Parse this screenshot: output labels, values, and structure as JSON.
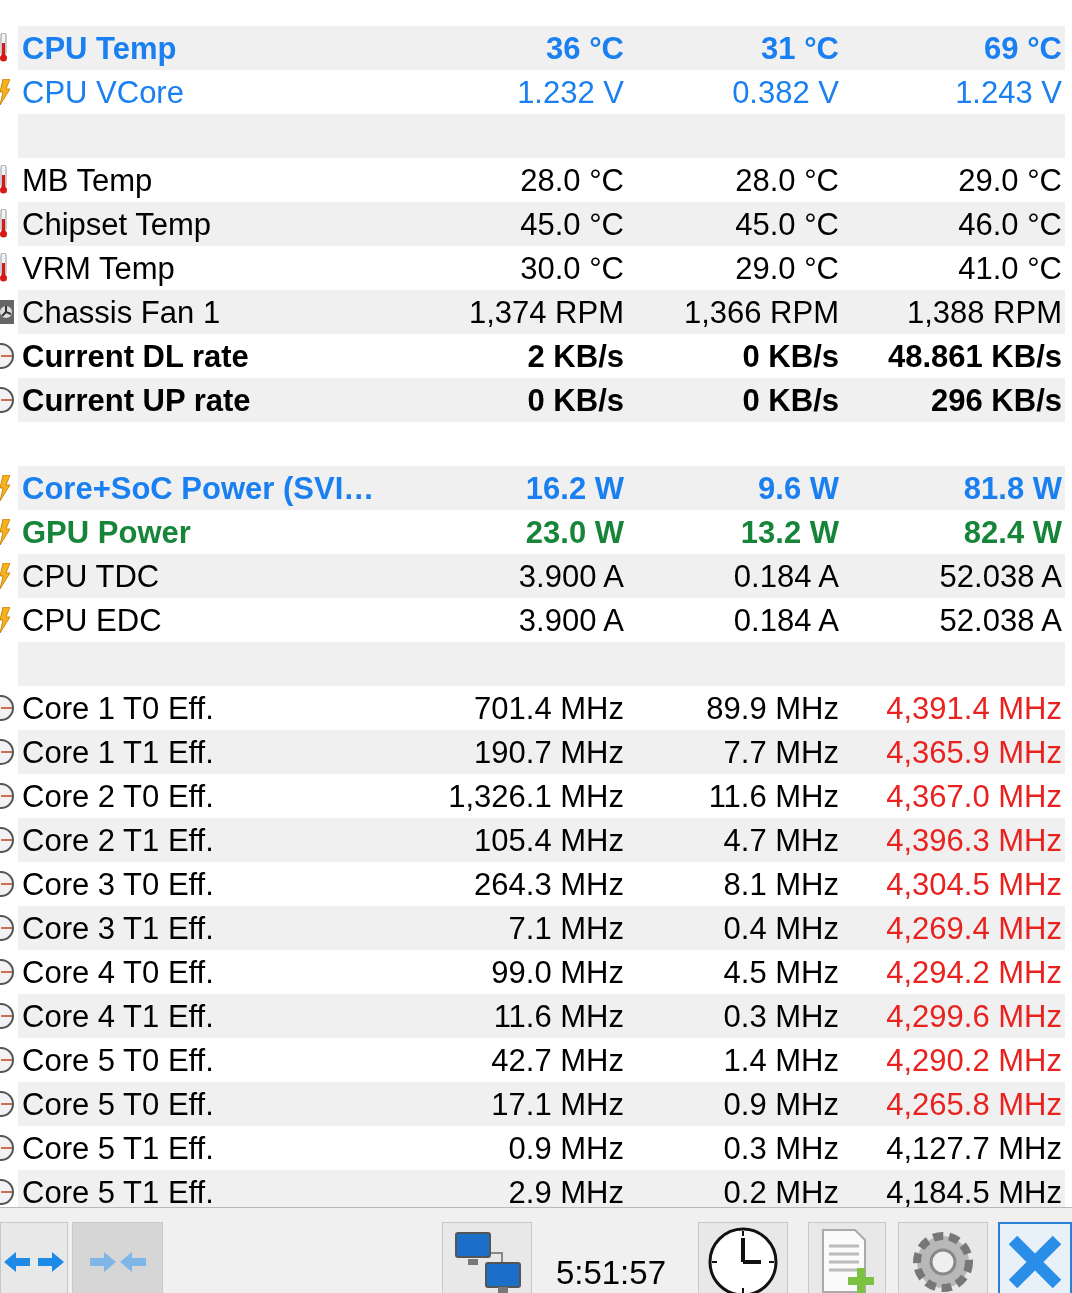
{
  "rows": [
    {
      "kind": "temperature",
      "bold": true,
      "color": "#1a7ff0",
      "name": "CPU Temp",
      "current": "36 °C",
      "minimum": "31 °C",
      "maximum": "69 °C",
      "max_alert": false
    },
    {
      "kind": "voltage",
      "bold": false,
      "color": "#1a7ff0",
      "name": "CPU VCore",
      "current": "1.232 V",
      "minimum": "0.382 V",
      "maximum": "1.243 V",
      "max_alert": false
    },
    {
      "kind": "gap"
    },
    {
      "kind": "temperature",
      "bold": false,
      "color": "#000000",
      "name": "MB Temp",
      "current": "28.0 °C",
      "minimum": "28.0 °C",
      "maximum": "29.0 °C",
      "max_alert": false
    },
    {
      "kind": "temperature",
      "bold": false,
      "color": "#000000",
      "name": "Chipset Temp",
      "current": "45.0 °C",
      "minimum": "45.0 °C",
      "maximum": "46.0 °C",
      "max_alert": false
    },
    {
      "kind": "temperature",
      "bold": false,
      "color": "#000000",
      "name": "VRM Temp",
      "current": "30.0 °C",
      "minimum": "29.0 °C",
      "maximum": "41.0 °C",
      "max_alert": false
    },
    {
      "kind": "fan",
      "bold": false,
      "color": "#000000",
      "name": "Chassis Fan 1",
      "current": "1,374 RPM",
      "minimum": "1,366 RPM",
      "maximum": "1,388 RPM",
      "max_alert": false
    },
    {
      "kind": "rate",
      "bold": true,
      "color": "#000000",
      "name": "Current DL rate",
      "current": "2 KB/s",
      "minimum": "0 KB/s",
      "maximum": "48.861 KB/s",
      "max_alert": false
    },
    {
      "kind": "rate",
      "bold": true,
      "color": "#000000",
      "name": "Current UP rate",
      "current": "0 KB/s",
      "minimum": "0 KB/s",
      "maximum": "296 KB/s",
      "max_alert": false
    },
    {
      "kind": "gap"
    },
    {
      "kind": "power",
      "bold": true,
      "color": "#1a7ff0",
      "name": "Core+SoC Power (SVI…",
      "current": "16.2 W",
      "minimum": "9.6 W",
      "maximum": "81.8 W",
      "max_alert": false
    },
    {
      "kind": "power",
      "bold": true,
      "color": "#16853a",
      "name": "GPU Power",
      "current": "23.0 W",
      "minimum": "13.2 W",
      "maximum": "82.4 W",
      "max_alert": false
    },
    {
      "kind": "power",
      "bold": false,
      "color": "#000000",
      "name": "CPU TDC",
      "current": "3.900 A",
      "minimum": "0.184 A",
      "maximum": "52.038 A",
      "max_alert": false
    },
    {
      "kind": "power",
      "bold": false,
      "color": "#000000",
      "name": "CPU EDC",
      "current": "3.900 A",
      "minimum": "0.184 A",
      "maximum": "52.038 A",
      "max_alert": false
    },
    {
      "kind": "gap"
    },
    {
      "kind": "clock",
      "bold": false,
      "color": "#000000",
      "name": "Core 1 T0 Eff.",
      "current": "701.4 MHz",
      "minimum": "89.9 MHz",
      "maximum": "4,391.4 MHz",
      "max_alert": true
    },
    {
      "kind": "clock",
      "bold": false,
      "color": "#000000",
      "name": "Core 1 T1 Eff.",
      "current": "190.7 MHz",
      "minimum": "7.7 MHz",
      "maximum": "4,365.9 MHz",
      "max_alert": true
    },
    {
      "kind": "clock",
      "bold": false,
      "color": "#000000",
      "name": "Core 2 T0 Eff.",
      "current": "1,326.1 MHz",
      "minimum": "11.6 MHz",
      "maximum": "4,367.0 MHz",
      "max_alert": true
    },
    {
      "kind": "clock",
      "bold": false,
      "color": "#000000",
      "name": "Core 2 T1 Eff.",
      "current": "105.4 MHz",
      "minimum": "4.7 MHz",
      "maximum": "4,396.3 MHz",
      "max_alert": true
    },
    {
      "kind": "clock",
      "bold": false,
      "color": "#000000",
      "name": "Core 3 T0 Eff.",
      "current": "264.3 MHz",
      "minimum": "8.1 MHz",
      "maximum": "4,304.5 MHz",
      "max_alert": true
    },
    {
      "kind": "clock",
      "bold": false,
      "color": "#000000",
      "name": "Core 3 T1 Eff.",
      "current": "7.1 MHz",
      "minimum": "0.4 MHz",
      "maximum": "4,269.4 MHz",
      "max_alert": true
    },
    {
      "kind": "clock",
      "bold": false,
      "color": "#000000",
      "name": "Core 4 T0 Eff.",
      "current": "99.0 MHz",
      "minimum": "4.5 MHz",
      "maximum": "4,294.2 MHz",
      "max_alert": true
    },
    {
      "kind": "clock",
      "bold": false,
      "color": "#000000",
      "name": "Core 4 T1 Eff.",
      "current": "11.6 MHz",
      "minimum": "0.3 MHz",
      "maximum": "4,299.6 MHz",
      "max_alert": true
    },
    {
      "kind": "clock",
      "bold": false,
      "color": "#000000",
      "name": "Core 5 T0 Eff.",
      "current": "42.7 MHz",
      "minimum": "1.4 MHz",
      "maximum": "4,290.2 MHz",
      "max_alert": true
    },
    {
      "kind": "clock",
      "bold": false,
      "color": "#000000",
      "name": "Core 5 T0 Eff.",
      "current": "17.1 MHz",
      "minimum": "0.9 MHz",
      "maximum": "4,265.8 MHz",
      "max_alert": true
    },
    {
      "kind": "clock",
      "bold": false,
      "color": "#000000",
      "name": "Core 5 T1 Eff.",
      "current": "0.9 MHz",
      "minimum": "0.3 MHz",
      "maximum": "4,127.7 MHz",
      "max_alert": false
    },
    {
      "kind": "clock",
      "bold": false,
      "color": "#000000",
      "name": "Core 5 T1 Eff.",
      "current": "2.9 MHz",
      "minimum": "0.2 MHz",
      "maximum": "4,184.5 MHz",
      "max_alert": false
    }
  ],
  "toolbar": {
    "buttons": [
      {
        "kind": "expand",
        "disabled": false,
        "selected": false
      },
      {
        "kind": "collapse",
        "disabled": true,
        "selected": false
      },
      {
        "kind": "spacer"
      },
      {
        "kind": "network",
        "disabled": false,
        "selected": false
      },
      {
        "kind": "time",
        "text": "5:51:57"
      },
      {
        "kind": "clock",
        "disabled": false,
        "selected": false
      },
      {
        "kind": "report",
        "disabled": false,
        "selected": false
      },
      {
        "kind": "settings",
        "disabled": false,
        "selected": false
      },
      {
        "kind": "close",
        "disabled": false,
        "selected": true
      }
    ]
  }
}
